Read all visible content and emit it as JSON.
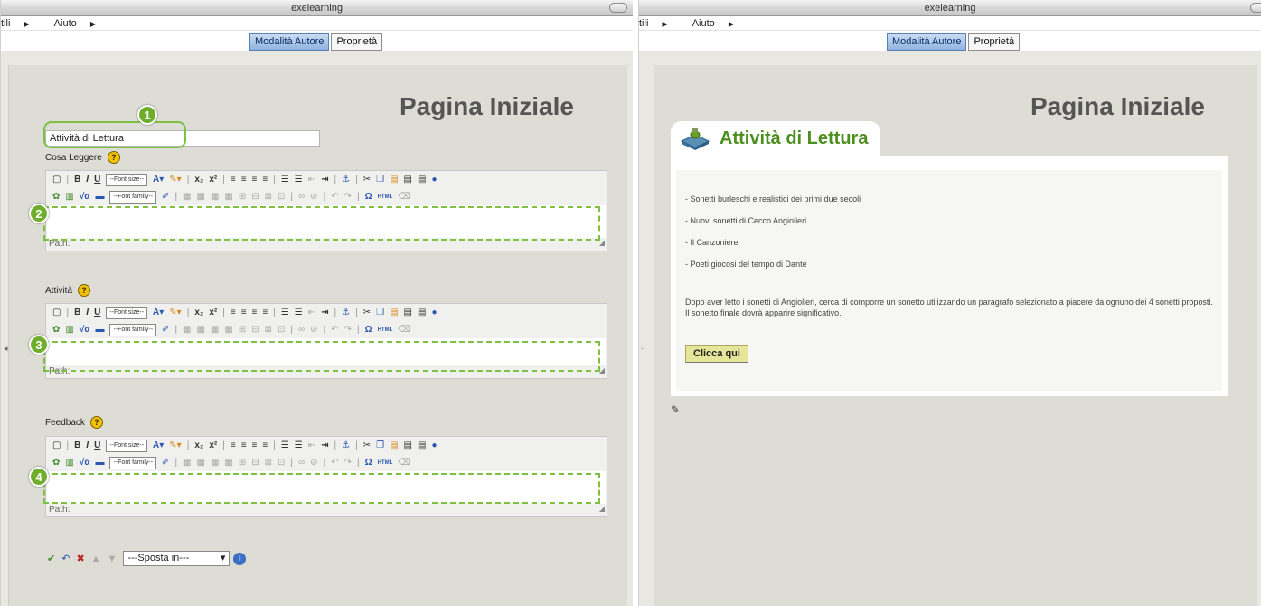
{
  "window_title": "exelearning",
  "menu": {
    "left_cut": "tili",
    "right_cut": "tili",
    "help": "Aiuto"
  },
  "tabs": {
    "author": "Modalità Autore",
    "properties": "Proprietà"
  },
  "page_title": "Pagina Iniziale",
  "editor": {
    "title_value": "Attività di Lettura",
    "fields": [
      {
        "label": "Cosa Leggere",
        "callout": "2"
      },
      {
        "label": "Attività",
        "callout": "3"
      },
      {
        "label": "Feedback",
        "callout": "4"
      }
    ],
    "title_callout": "1",
    "font_size_select": "--Font size--",
    "font_family_select": "--Font family--",
    "path_label": "Path:",
    "html_btn": "HTML",
    "move_select": "---Sposta in---"
  },
  "preview": {
    "idevice_title": "Attività di Lettura",
    "list": [
      "- Sonetti burleschi e realistici dei primi due secoli",
      "- Nuovi sonetti di Cecco Angiolieri",
      "- Il Canzoniere",
      "- Poeti giocosi del tempo di Dante"
    ],
    "paragraph": "Dopo aver letto i sonetti di Angiolieri, cerca di comporre un sonetto utilizzando un paragrafo selezionato a piacere da ognuno dei 4 sonetti proposti. Il sonetto finale dovrà apparire significativo.",
    "button": "Clicca qui"
  },
  "colors": {
    "highlight": "#7cc142",
    "title_green": "#4d8f1f",
    "active_tab": "#8fb3df"
  }
}
